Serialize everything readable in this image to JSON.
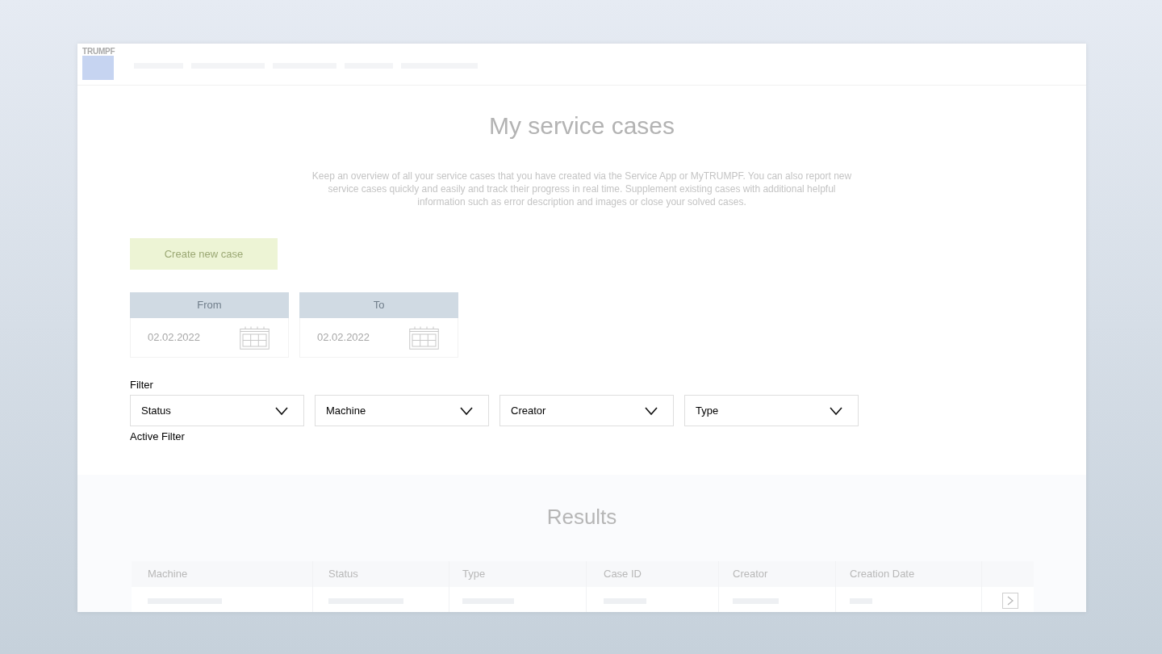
{
  "header": {
    "logo": "TRUMPF"
  },
  "intro": {
    "title": "My service cases",
    "description": "Keep an overview of all your service cases that you have created via the Service App or MyTRUMPF. You can also report new service cases quickly and easily and track their progress in real time. Supplement existing cases with additional helpful information such as error description and images or close your solved cases."
  },
  "create_button": {
    "label": "Create new case"
  },
  "date_range": [
    {
      "label": "From",
      "value": "02.02.2022"
    },
    {
      "label": "To",
      "value": "02.02.2022"
    }
  ],
  "filter": {
    "label": "Filter",
    "dropdowns": [
      {
        "label": "Status"
      },
      {
        "label": "Machine"
      },
      {
        "label": "Creator"
      },
      {
        "label": "Type"
      }
    ],
    "active_label": "Active Filter"
  },
  "results": {
    "title": "Results",
    "table": {
      "columns": [
        "Machine",
        "Status",
        "Type",
        "Case ID",
        "Creator",
        "Creation Date"
      ]
    }
  }
}
